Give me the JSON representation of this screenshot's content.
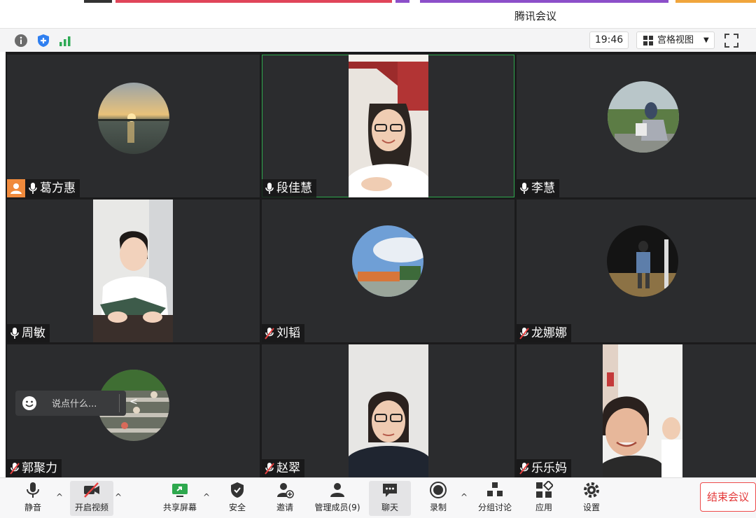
{
  "window": {
    "title": "腾讯会议"
  },
  "info_bar": {
    "time": "19:46",
    "view_mode": "宫格视图"
  },
  "participants": [
    {
      "name": "葛方惠",
      "host": true,
      "mic": "on",
      "media": "avatar",
      "avatar": "sunset-lake"
    },
    {
      "name": "段佳慧",
      "host": false,
      "mic": "on",
      "media": "video",
      "active_speaker": true
    },
    {
      "name": "李慧",
      "host": false,
      "mic": "on",
      "media": "avatar",
      "avatar": "person-sitting-outdoors"
    },
    {
      "name": "周敏",
      "host": false,
      "mic": "on",
      "media": "video"
    },
    {
      "name": "刘韬",
      "host": false,
      "mic": "muted",
      "media": "avatar",
      "avatar": "sky-building"
    },
    {
      "name": "龙娜娜",
      "host": false,
      "mic": "muted",
      "media": "avatar",
      "avatar": "child-night"
    },
    {
      "name": "郭聚力",
      "host": false,
      "mic": "muted",
      "media": "avatar",
      "avatar": "plant-shelves"
    },
    {
      "name": "赵翠",
      "host": false,
      "mic": "muted",
      "media": "video"
    },
    {
      "name": "乐乐妈",
      "host": false,
      "mic": "muted",
      "media": "video"
    }
  ],
  "chat_popup": {
    "placeholder": "说点什么..."
  },
  "toolbar": {
    "mute": "静音",
    "video": "开启视频",
    "share": "共享屏幕",
    "security": "安全",
    "invite": "邀请",
    "members": "管理成员(9)",
    "chat": "聊天",
    "record": "录制",
    "breakout": "分组讨论",
    "apps": "应用",
    "settings": "设置",
    "end": "结束会议"
  },
  "colors": {
    "active_speaker_border": "#2ea84e",
    "host_badge": "#f08a3c",
    "end_button": "#e43a3a",
    "tile_bg": "#2b2c2e"
  }
}
